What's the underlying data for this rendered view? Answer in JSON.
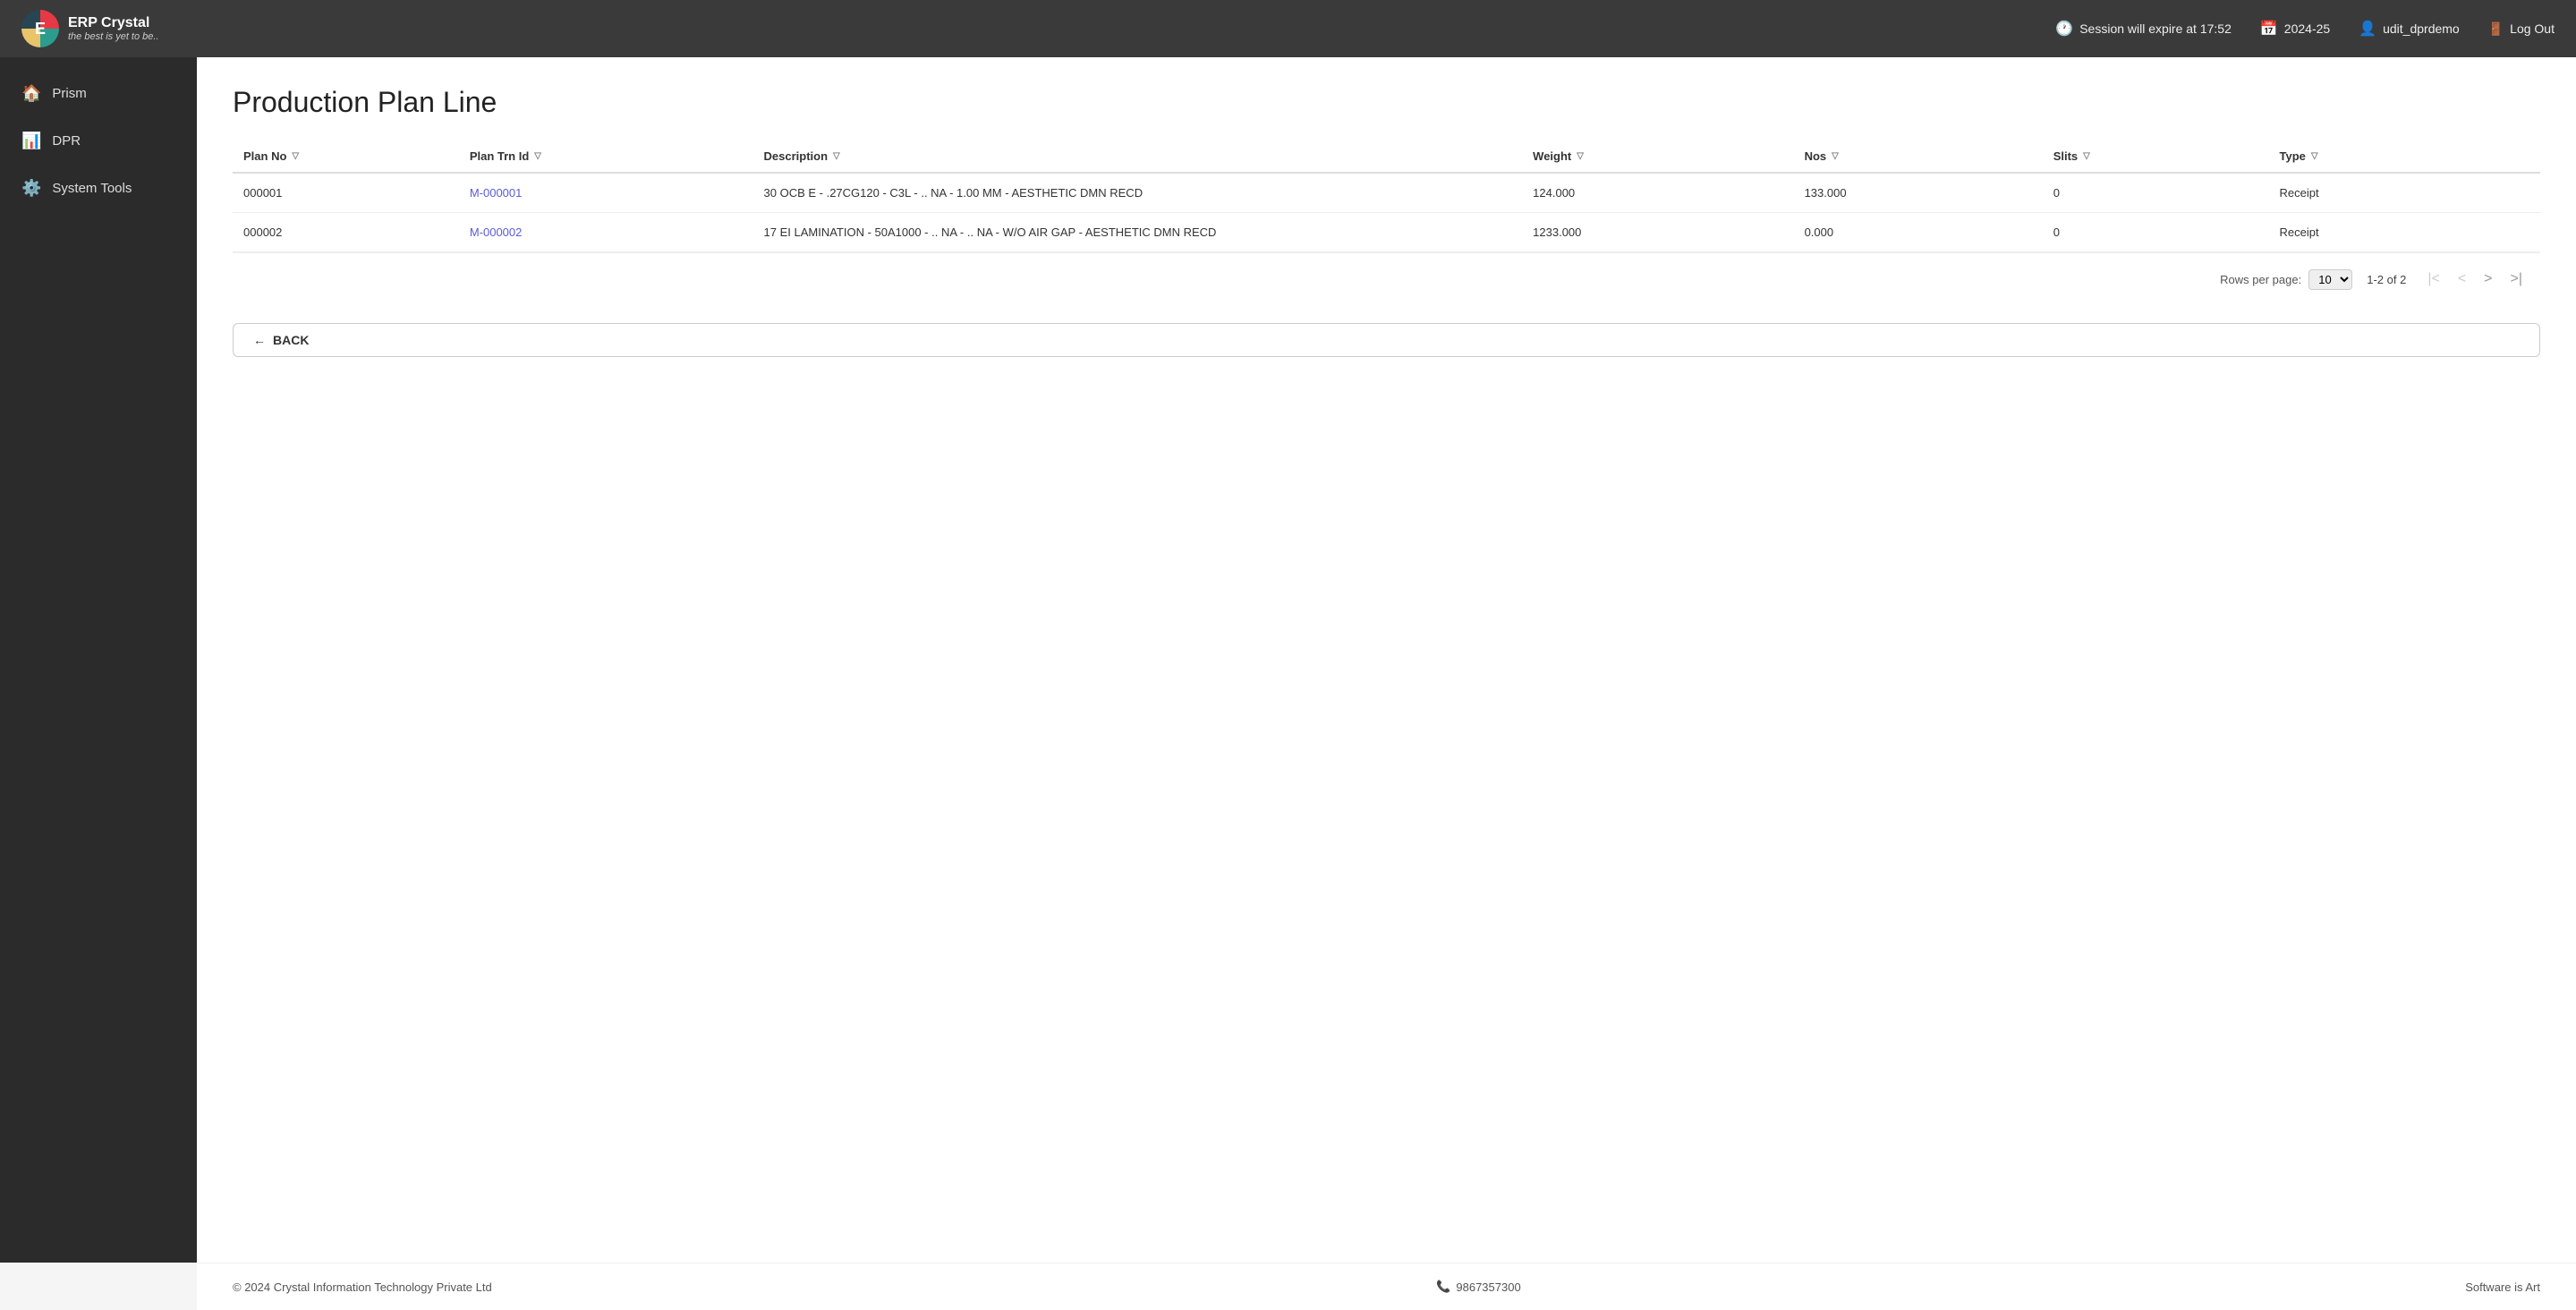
{
  "header": {
    "logo_letter": "E",
    "app_name": "ERP Crystal",
    "app_subtitle": "the best is yet to be..",
    "session_label": "Session will expire at 17:52",
    "year_label": "2024-25",
    "user_label": "udit_dprdemo",
    "logout_label": "Log Out"
  },
  "sidebar": {
    "items": [
      {
        "id": "prism",
        "label": "Prism",
        "icon": "🏠"
      },
      {
        "id": "dpr",
        "label": "DPR",
        "icon": "📊"
      },
      {
        "id": "system-tools",
        "label": "System Tools",
        "icon": "⚙️"
      }
    ]
  },
  "main": {
    "page_title": "Production Plan Line",
    "table": {
      "columns": [
        {
          "id": "plan_no",
          "label": "Plan No"
        },
        {
          "id": "plan_trn_id",
          "label": "Plan Trn Id"
        },
        {
          "id": "description",
          "label": "Description"
        },
        {
          "id": "weight",
          "label": "Weight"
        },
        {
          "id": "nos",
          "label": "Nos"
        },
        {
          "id": "slits",
          "label": "Slits"
        },
        {
          "id": "type",
          "label": "Type"
        }
      ],
      "rows": [
        {
          "plan_no": "000001",
          "plan_trn_id": "M-000001",
          "description": "30 OCB E - .27CG120 - C3L - .. NA - 1.00 MM - AESTHETIC DMN RECD",
          "weight": "124.000",
          "nos": "133.000",
          "slits": "0",
          "type": "Receipt"
        },
        {
          "plan_no": "000002",
          "plan_trn_id": "M-000002",
          "description": "17 EI LAMINATION - 50A1000 - .. NA - .. NA - W/O AIR GAP - AESTHETIC DMN RECD",
          "weight": "1233.000",
          "nos": "0.000",
          "slits": "0",
          "type": "Receipt"
        }
      ]
    },
    "pagination": {
      "rows_per_page_label": "Rows per page:",
      "rows_per_page_value": "10",
      "page_info": "1-2 of 2"
    },
    "back_button_label": "BACK"
  },
  "footer": {
    "copyright": "© 2024 Crystal Information Technology Private Ltd",
    "phone": "9867357300",
    "tagline": "Software is Art"
  }
}
